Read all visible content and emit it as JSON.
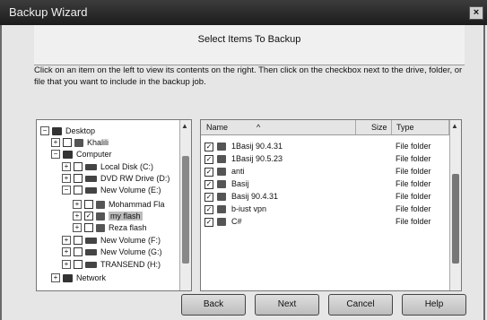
{
  "window": {
    "title": "Backup Wizard",
    "close_glyph": "×"
  },
  "header": {
    "heading": "Select Items To Backup"
  },
  "instructions": "Click on an item on the left to view its contents on the right.  Then click on the checkbox next to the drive, folder, or file that you want to include in the backup job.",
  "tree": {
    "desktop": "Desktop",
    "khalil": "Khalili",
    "computer": "Computer",
    "local_disk": "Local Disk (C:)",
    "dvd": "DVD RW Drive (D:)",
    "new_volume_e": "New Volume (E:)",
    "mohammad": "Mohammad Fla",
    "my_flash": "my flash",
    "reza": "Reza flash",
    "new_volume_f": "New Volume (F:)",
    "new_volume_g": "New Volume (G:)",
    "transend": "TRANSEND (H:)",
    "network": "Network"
  },
  "list": {
    "columns": {
      "name": "Name",
      "size": "Size",
      "type": "Type"
    },
    "rows": [
      {
        "name": "1Basij 90.4.31",
        "type": "File folder"
      },
      {
        "name": "1Basij 90.5.23",
        "type": "File folder"
      },
      {
        "name": "anti",
        "type": "File folder"
      },
      {
        "name": "Basij",
        "type": "File folder"
      },
      {
        "name": "Basij 90.4.31",
        "type": "File folder"
      },
      {
        "name": "b-iust vpn",
        "type": "File folder"
      },
      {
        "name": "C#",
        "type": "File folder"
      }
    ]
  },
  "buttons": {
    "back": "Back",
    "next": "Next",
    "cancel": "Cancel",
    "help": "Help"
  },
  "glyphs": {
    "expand_plus": "+",
    "collapse_minus": "−",
    "check": "✓",
    "scroll_up": "▲",
    "scroll_down": "▼",
    "sort_up": "^"
  }
}
